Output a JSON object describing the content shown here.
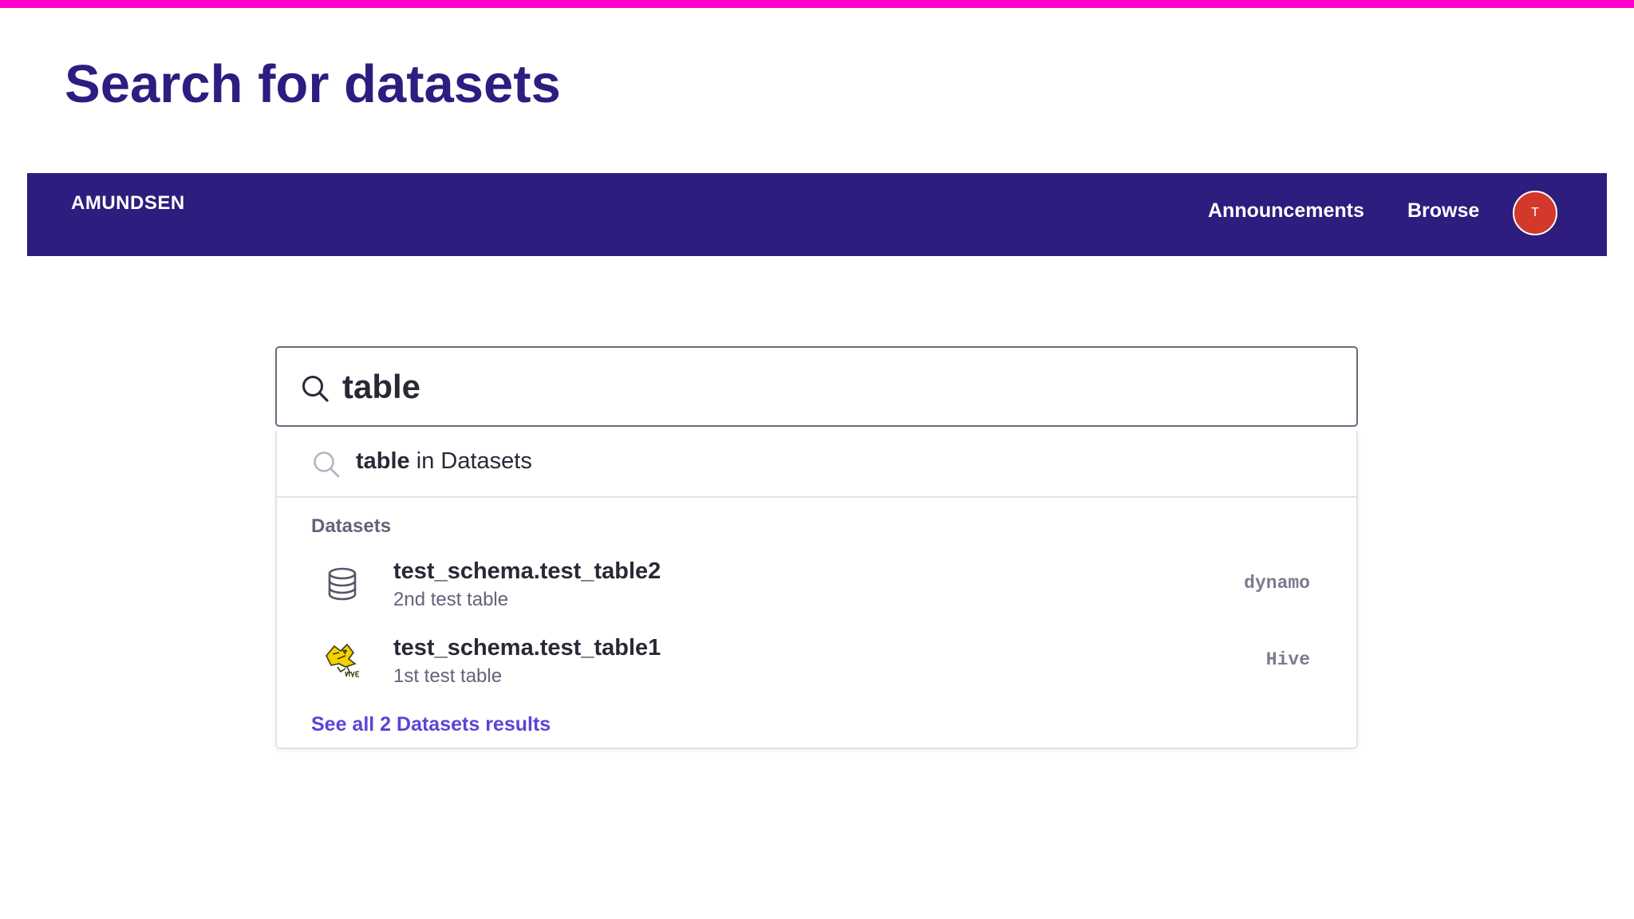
{
  "slide": {
    "title": "Search for datasets",
    "accent_color": "#ff00cc",
    "title_color": "#2e1c80"
  },
  "navbar": {
    "brand": "AMUNDSEN",
    "links": [
      "Announcements",
      "Browse"
    ],
    "avatar_initial": "T",
    "background": "#2e1c7e",
    "avatar_color": "#d2392b"
  },
  "search": {
    "query": "table",
    "icon": "search-icon"
  },
  "dropdown": {
    "suggestion": {
      "term": "table",
      "suffix": " in Datasets",
      "icon": "search-icon"
    },
    "section_label": "Datasets",
    "results": [
      {
        "title": "test_schema.test_table2",
        "description": "2nd test table",
        "source": "dynamo",
        "icon": "database-icon"
      },
      {
        "title": "test_schema.test_table1",
        "description": "1st test table",
        "source": "Hive",
        "icon": "hive-logo-icon"
      }
    ],
    "see_all": "See all 2 Datasets results",
    "link_color": "#5d43d6"
  }
}
